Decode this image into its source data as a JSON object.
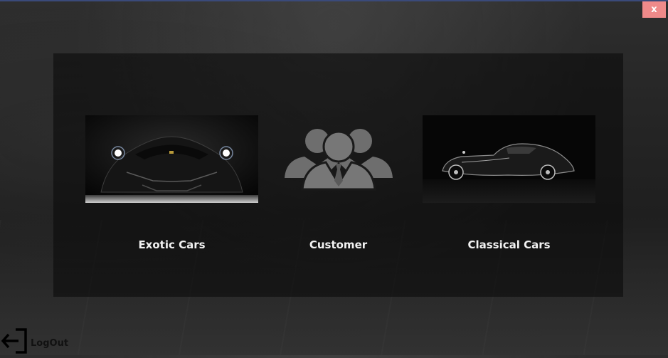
{
  "window": {
    "close_label": "x",
    "accent_color": "#ef8a8a"
  },
  "menu": {
    "cards": [
      {
        "label": "Exotic Cars",
        "icon": "exotic-car-image"
      },
      {
        "label": "Customer",
        "icon": "customers-group-icon"
      },
      {
        "label": "Classical Cars",
        "icon": "classic-car-image"
      }
    ]
  },
  "footer": {
    "logout_label": "LogOut",
    "logout_icon": "logout-icon"
  }
}
